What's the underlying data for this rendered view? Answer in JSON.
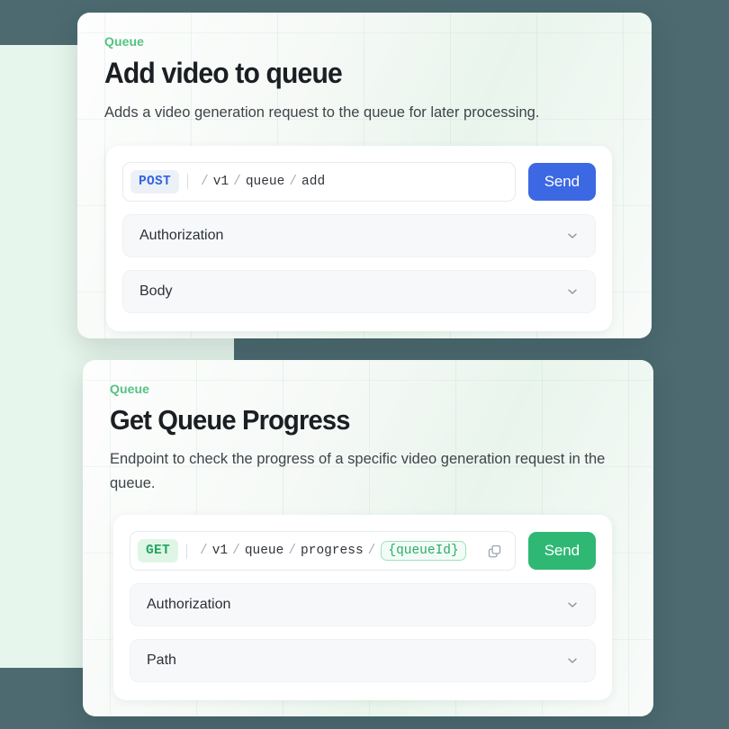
{
  "theme": {
    "background": "#4C6A70",
    "blob": "#E6F6EC",
    "card_bg": "#F2F7F3",
    "accent_green": "#55C283",
    "accent_blue": "#3C68E3",
    "send_green": "#2FB874"
  },
  "cards": [
    {
      "eyebrow": "Queue",
      "title": "Add video to queue",
      "description": "Adds a video generation request to the queue for later processing.",
      "endpoint": {
        "method": "POST",
        "method_style": "post",
        "segments": [
          {
            "text": "v1",
            "type": "static"
          },
          {
            "text": "queue",
            "type": "static"
          },
          {
            "text": "add",
            "type": "static"
          }
        ],
        "has_copy": false,
        "copy_icon": "copy-icon",
        "send_label": "Send",
        "send_style": "blue"
      },
      "sections": [
        {
          "label": "Authorization",
          "icon": "chevron-down-icon"
        },
        {
          "label": "Body",
          "icon": "chevron-down-icon"
        }
      ]
    },
    {
      "eyebrow": "Queue",
      "title": "Get Queue Progress",
      "description": "Endpoint to check the progress of a specific video generation request in the queue.",
      "endpoint": {
        "method": "GET",
        "method_style": "get",
        "segments": [
          {
            "text": "v1",
            "type": "static"
          },
          {
            "text": "queue",
            "type": "static"
          },
          {
            "text": "progress",
            "type": "static"
          },
          {
            "text": "{queueId}",
            "type": "variable"
          }
        ],
        "has_copy": true,
        "copy_icon": "copy-icon",
        "send_label": "Send",
        "send_style": "green"
      },
      "sections": [
        {
          "label": "Authorization",
          "icon": "chevron-down-icon"
        },
        {
          "label": "Path",
          "icon": "chevron-down-icon"
        }
      ]
    }
  ]
}
